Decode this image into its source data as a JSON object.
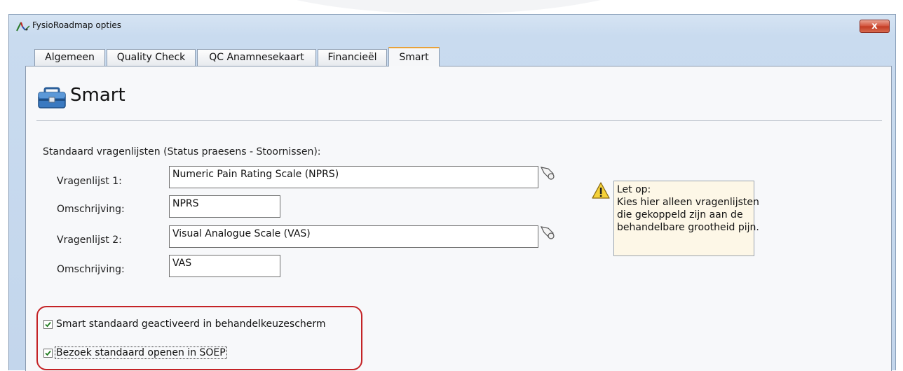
{
  "window": {
    "title": "FysioRoadmap opties",
    "close_label": "x"
  },
  "tabs": [
    {
      "label": "Algemeen",
      "active": false
    },
    {
      "label": "Quality Check",
      "active": false
    },
    {
      "label": "QC Anamnesekaart",
      "active": false
    },
    {
      "label": "Financieël",
      "active": false
    },
    {
      "label": "Smart",
      "active": true
    }
  ],
  "header": {
    "title": "Smart",
    "icon": "toolbox-icon"
  },
  "form": {
    "section_label": "Standaard vragenlijsten (Status praesens - Stoornissen):",
    "vragenlijst1_label": "Vragenlijst 1:",
    "vragenlijst1_value": "Numeric Pain Rating Scale (NPRS)",
    "omschrijving1_label": "Omschrijving:",
    "omschrijving1_value": "NPRS",
    "vragenlijst2_label": "Vragenlijst 2:",
    "vragenlijst2_value": "Visual Analogue Scale (VAS)",
    "omschrijving2_label": "Omschrijving:",
    "omschrijving2_value": "VAS"
  },
  "note": {
    "title": "Let op:",
    "lines": [
      "Kies hier alleen vragenlijsten",
      "die gekoppeld zijn aan de",
      "behandelbare grootheid pijn."
    ]
  },
  "checkboxes": {
    "smart_default": {
      "label": "Smart standaard geactiveerd in behandelkeuzescherm",
      "checked": true
    },
    "bezoek_default": {
      "label": "Bezoek standaard openen in SOEP",
      "checked": true
    }
  },
  "colors": {
    "highlight": "#c42326",
    "active_tab_accent": "#e8a23a",
    "note_background": "#fdf7e7"
  }
}
